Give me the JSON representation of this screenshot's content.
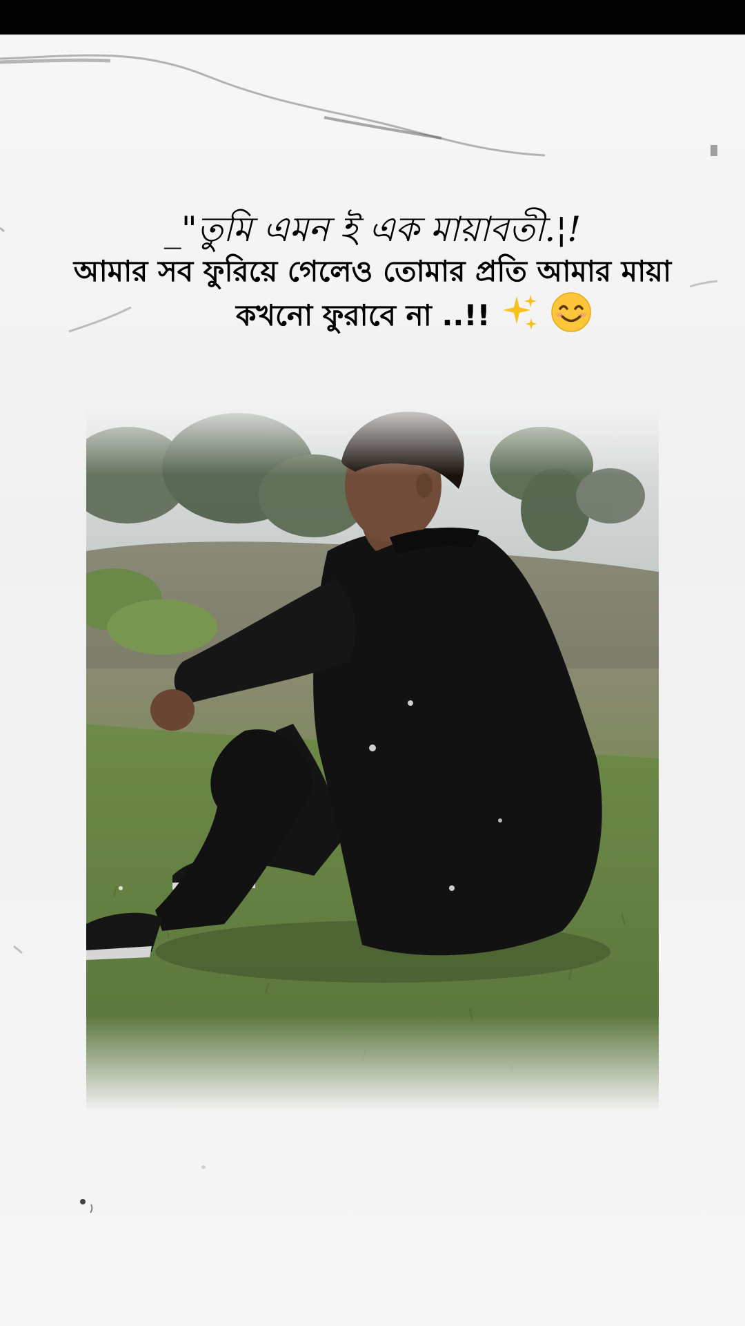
{
  "caption": {
    "title": "_\"তুমি এমন ই এক মায়াবতী.¦!",
    "line2": "আমার সব ফুরিয়ে গেলেও তোমার প্রতি আমার মায়া",
    "line3": "কখনো ফুরাবে না ..!!",
    "emoji_sparkles": "✨",
    "emoji_smile": "😊"
  },
  "photo": {
    "subject": "young-man-black-outfit-sitting-on-grass",
    "colors": {
      "sky": "#d4d8d8",
      "trees": "#4f6048",
      "grass": "#6f8a45",
      "outfit": "#111111"
    }
  },
  "icons": {
    "sparkles": "sparkles-icon",
    "smile": "smiling-face-icon"
  }
}
